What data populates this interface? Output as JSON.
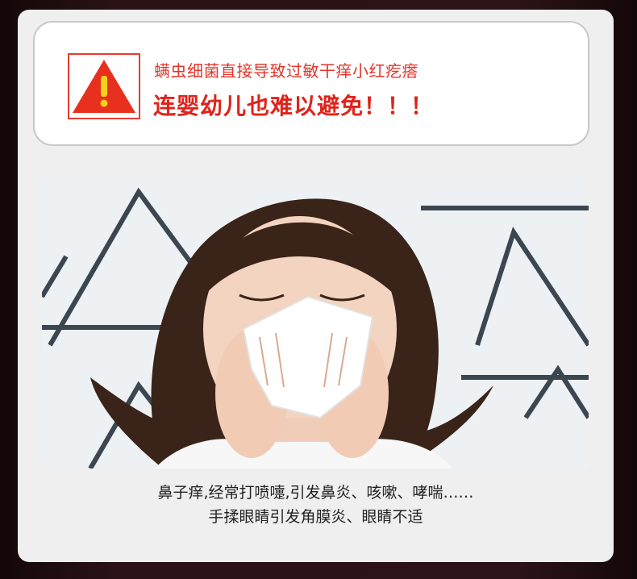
{
  "warning": {
    "icon": "warning-triangle-icon",
    "line1": "螨虫细菌直接导致过敏干痒小红疙瘩",
    "line2": "连婴幼儿也难以避免！！！",
    "accent_color": "#e0231b",
    "icon_fill": "#e8301f",
    "icon_mark": "#f3d21a"
  },
  "photo": {
    "subject": "woman-sneezing-into-tissue-image"
  },
  "captions": {
    "line1": "鼻子痒,经常打喷嚏,引发鼻炎、咳嗽、哮喘……",
    "line2": "手揉眼睛引发角膜炎、眼睛不适"
  }
}
